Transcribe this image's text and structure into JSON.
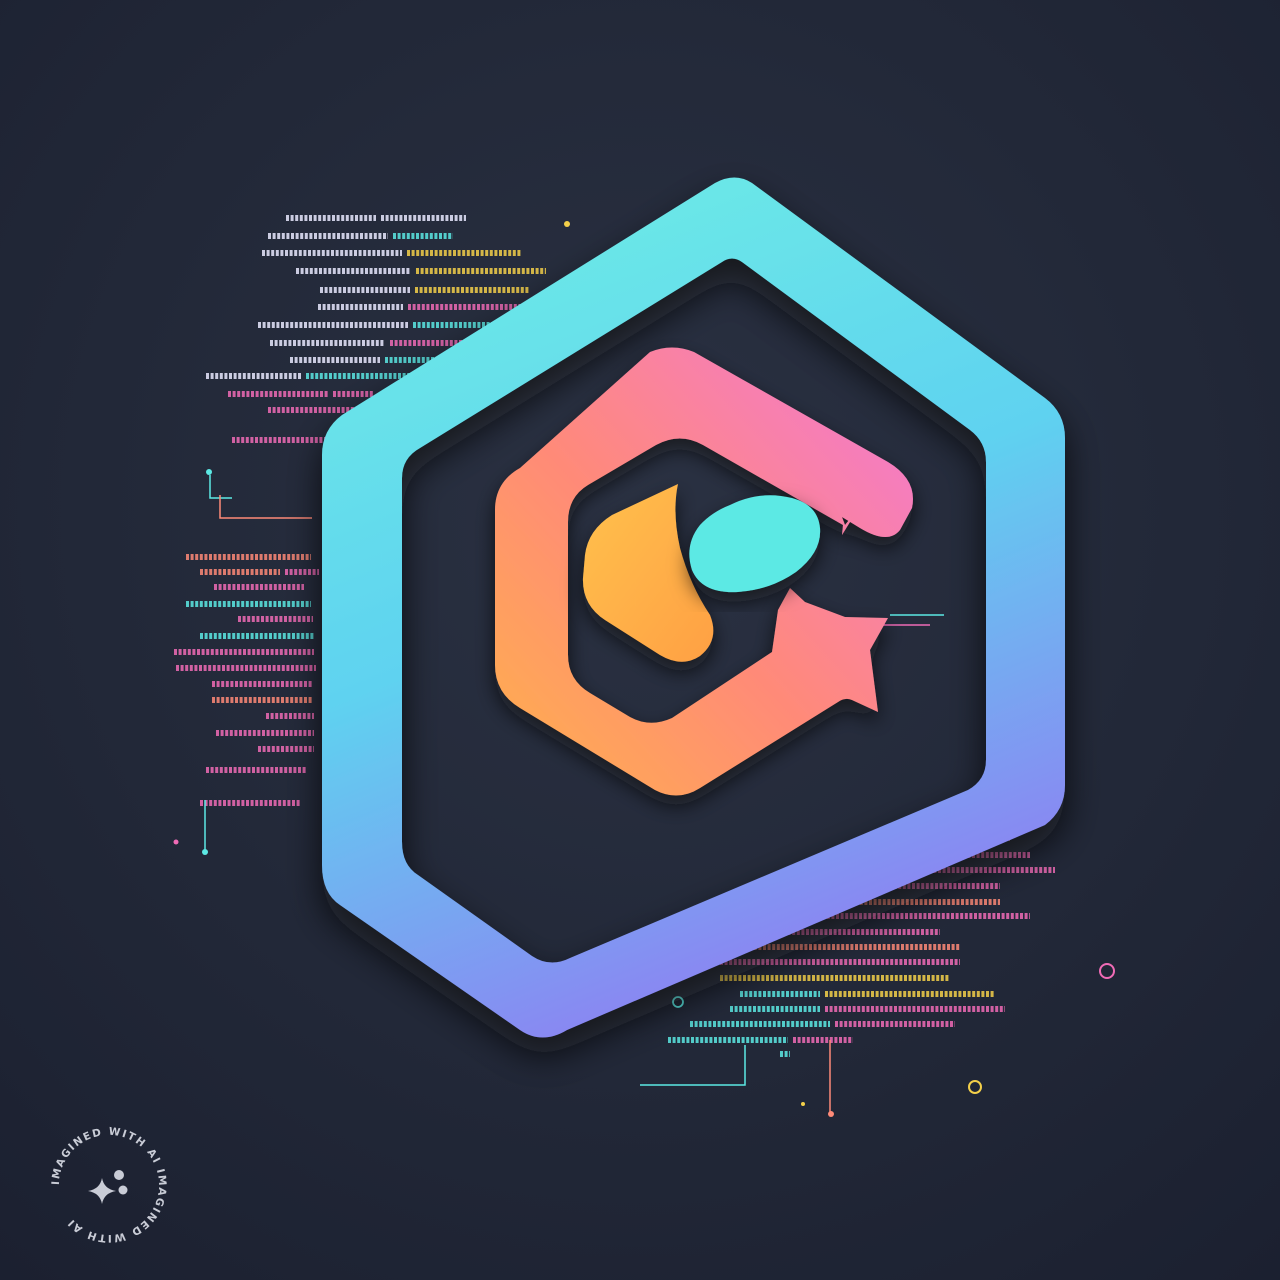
{
  "image": {
    "kind": "logo-render",
    "background_color": "#232a3a"
  },
  "logo": {
    "outer_hexagon_gradient": [
      "#6ff0e4",
      "#5fd2f0",
      "#8a86f2"
    ],
    "inner_glyph_gradient": [
      "#ffb24a",
      "#ff8a78",
      "#f278d8"
    ],
    "inner_pill_color": "#5ce9e4",
    "inner_drop_color": "#ffb24a"
  },
  "decor": {
    "code_line_colors": [
      "#e9e9ff",
      "#5ce9e4",
      "#f4d04a",
      "#f06bb6",
      "#ff8a78"
    ],
    "dot_colors": [
      "#f4d04a",
      "#5ce9e4",
      "#f06bb6",
      "#ff8a78"
    ]
  },
  "watermark": {
    "text": "IMAGINED WITH AI IMAGINED WITH AI",
    "icon": "sparkle-icon"
  }
}
